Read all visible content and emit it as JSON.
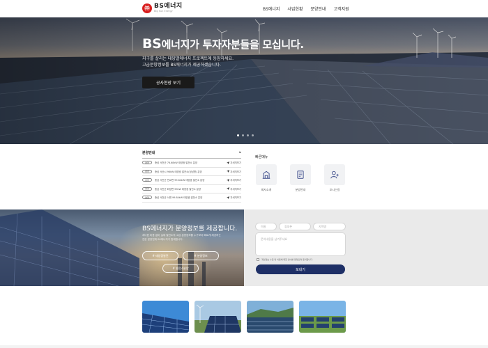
{
  "header": {
    "logo_mark": "㈜",
    "logo_name": "BS에너지",
    "logo_sub": "Big Sun Energy",
    "nav": [
      "BS에너지",
      "사업현황",
      "분양안내",
      "고객지원"
    ]
  },
  "hero": {
    "title_big": "BS",
    "title_rest": "에너지가 투자자분들을 모십니다.",
    "desc_1": "지구를 살리는 태양열에너지 프로젝트에 동참하세요.",
    "desc_2": "고급분양정보를 BS에너지가 제공하겠습니다.",
    "button": "공사현장 보기",
    "slides": 4,
    "active_slide": 1
  },
  "notice": {
    "title": "분양안내",
    "more_icon": "▸",
    "rows": [
      {
        "badge": "분양",
        "text": "충남 서천군 76.68kW 태양광 발전소 분양",
        "more": "자세히보기"
      },
      {
        "badge": "분양",
        "text": "충남 서산시 96kW 태양광 발전소(정남향) 분양",
        "more": "자세히보기"
      },
      {
        "badge": "분양",
        "text": "충남 서천군 판교면 99.84kW 태양광 발전소 분양",
        "more": "자세히보기"
      },
      {
        "badge": "분양",
        "text": "충남 서천군 화양면 99kW 태양광 발전소 분양",
        "more": "자세히보기"
      },
      {
        "badge": "분양",
        "text": "충남 서천군 서면 99.84kW 태양광 발전소 분양",
        "more": "자세히보기"
      }
    ]
  },
  "quick": {
    "title": "빠른메뉴",
    "items": [
      {
        "label": "회사소개",
        "icon": "building-icon"
      },
      {
        "label": "분양안내",
        "icon": "document-icon"
      },
      {
        "label": "오시는길",
        "icon": "user-add-icon"
      }
    ]
  },
  "mid": {
    "title": "BS에너지가 분양정보를 제공합니다.",
    "desc_1": "과다한 비용 없이 실제 발전소의 고급 분양정보를 누구보다 빠르게 제공하는",
    "desc_2": "전문 분양업체 BS에너지가 함께합니다.",
    "pills": [
      "# 태양광발전",
      "# 분양정보",
      "# 발전소분양"
    ]
  },
  "form": {
    "name_placeholder": "이름",
    "phone_placeholder": "휴대폰",
    "region_placeholder": "지역명",
    "message_placeholder": "문의내용을 남겨주세요",
    "agree_text": "개인정보 수집 및 이용에 대한 안내를 읽었으며 동의합니다.",
    "submit": "보내기"
  },
  "colors": {
    "accent": "#1e2f66",
    "logo_red": "#d81e1e",
    "hero_button": "#1a1a1a"
  }
}
